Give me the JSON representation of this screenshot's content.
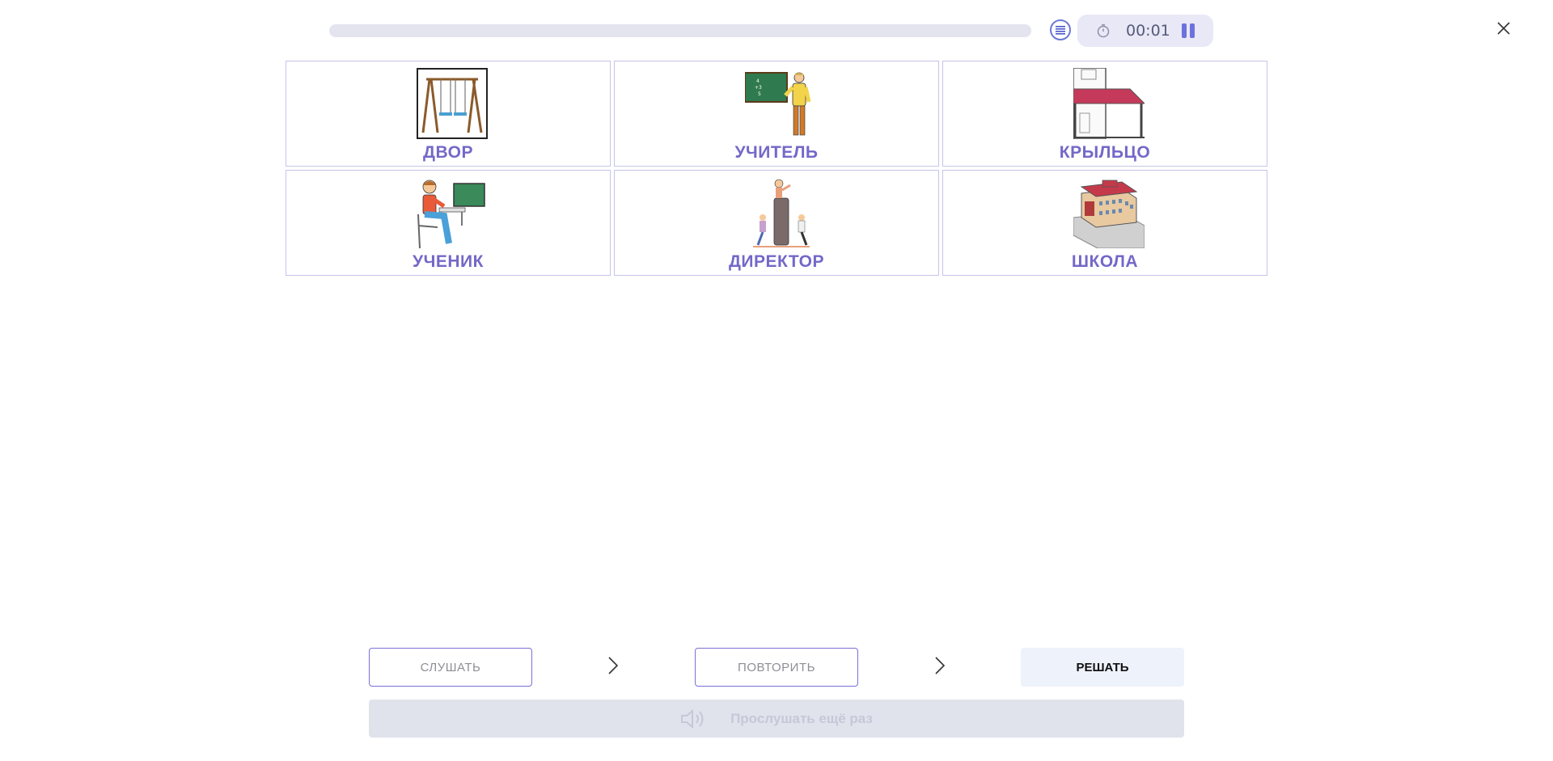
{
  "header": {
    "progress_value": 0,
    "timer": "00:01",
    "icons": {
      "list": "list-icon",
      "clock": "stopwatch-icon",
      "pause": "pause-icon",
      "close": "close-icon"
    },
    "accent_color": "#6c72dc"
  },
  "cards": [
    {
      "word": "ДВОР",
      "image": "swing-picture"
    },
    {
      "word": "УЧИТЕЛЬ",
      "image": "teacher-at-blackboard-picture"
    },
    {
      "word": "КРЫЛЬЦО",
      "image": "porch-picture"
    },
    {
      "word": "УЧЕНИК",
      "image": "student-at-desk-picture"
    },
    {
      "word": "ДИРЕКТОР",
      "image": "director-picture"
    },
    {
      "word": "ШКОЛА",
      "image": "school-building-picture"
    }
  ],
  "steps": {
    "listen_label": "СЛУШАТЬ",
    "repeat_label": "ПОВТОРИТЬ",
    "solve_label": "РЕШАТЬ"
  },
  "replay": {
    "label": "Прослушать ещё раз",
    "icon": "speaker-icon"
  }
}
